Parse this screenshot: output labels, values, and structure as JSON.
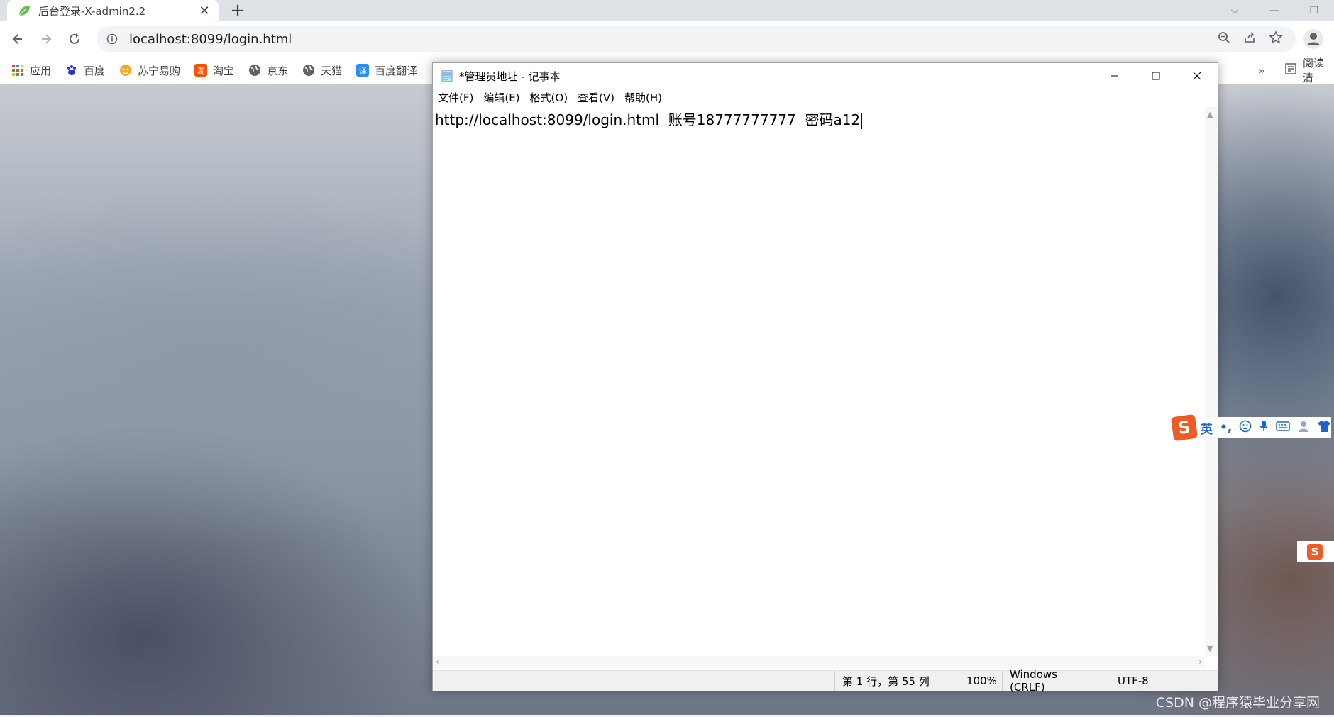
{
  "browser": {
    "tab_title": "后台登录-X-admin2.2",
    "tab_close": "✕",
    "new_tab": "+",
    "url": "localhost:8099/login.html",
    "bookmarks": [
      {
        "label": "应用",
        "icon": "apps-grid-icon",
        "color": "#4285f4"
      },
      {
        "label": "百度",
        "icon": "baidu-paw-icon",
        "color": "#2932e1"
      },
      {
        "label": "苏宁易购",
        "icon": "suning-icon",
        "color": "#f5a623"
      },
      {
        "label": "淘宝",
        "icon": "taobao-icon",
        "color": "#ff5000"
      },
      {
        "label": "京东",
        "icon": "globe-icon",
        "color": "#5f6368"
      },
      {
        "label": "天猫",
        "icon": "globe-icon",
        "color": "#5f6368"
      },
      {
        "label": "百度翻译",
        "icon": "translate-icon",
        "color": "#2d8cf0"
      }
    ],
    "bookmarks_more": "»",
    "reading_list": "阅读清"
  },
  "notepad": {
    "title": "*管理员地址 - 记事本",
    "menu": [
      "文件(F)",
      "编辑(E)",
      "格式(O)",
      "查看(V)",
      "帮助(H)"
    ],
    "content": "http://localhost:8099/login.html  账号18777777777  密码a12",
    "status": {
      "position": "第 1 行，第 55 列",
      "zoom": "100%",
      "line_ending": "Windows (CRLF)",
      "encoding": "UTF-8"
    }
  },
  "ime": {
    "logo": "S",
    "mode": "英",
    "punct": "•,"
  },
  "watermark": "CSDN @程序猿毕业分享网"
}
